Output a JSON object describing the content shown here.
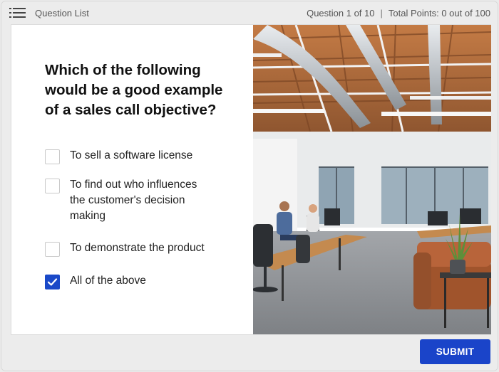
{
  "topbar": {
    "question_list_label": "Question List",
    "progress": "Question 1 of 10",
    "separator": "|",
    "points": "Total Points: 0 out of 100"
  },
  "question": {
    "title": "Which of the following would be a good example of a sales call objective?",
    "options": [
      {
        "label": "To sell a software license",
        "checked": false
      },
      {
        "label": "To find out who influences the customer's decision making",
        "checked": false
      },
      {
        "label": "To demonstrate the product",
        "checked": false
      },
      {
        "label": "All of the above",
        "checked": true
      }
    ]
  },
  "submit": {
    "label": "SUBMIT"
  },
  "colors": {
    "accent": "#1a44c9",
    "checked": "#1a49c8"
  },
  "icons": {
    "menu": "list-menu-icon",
    "check": "checkmark-icon"
  }
}
